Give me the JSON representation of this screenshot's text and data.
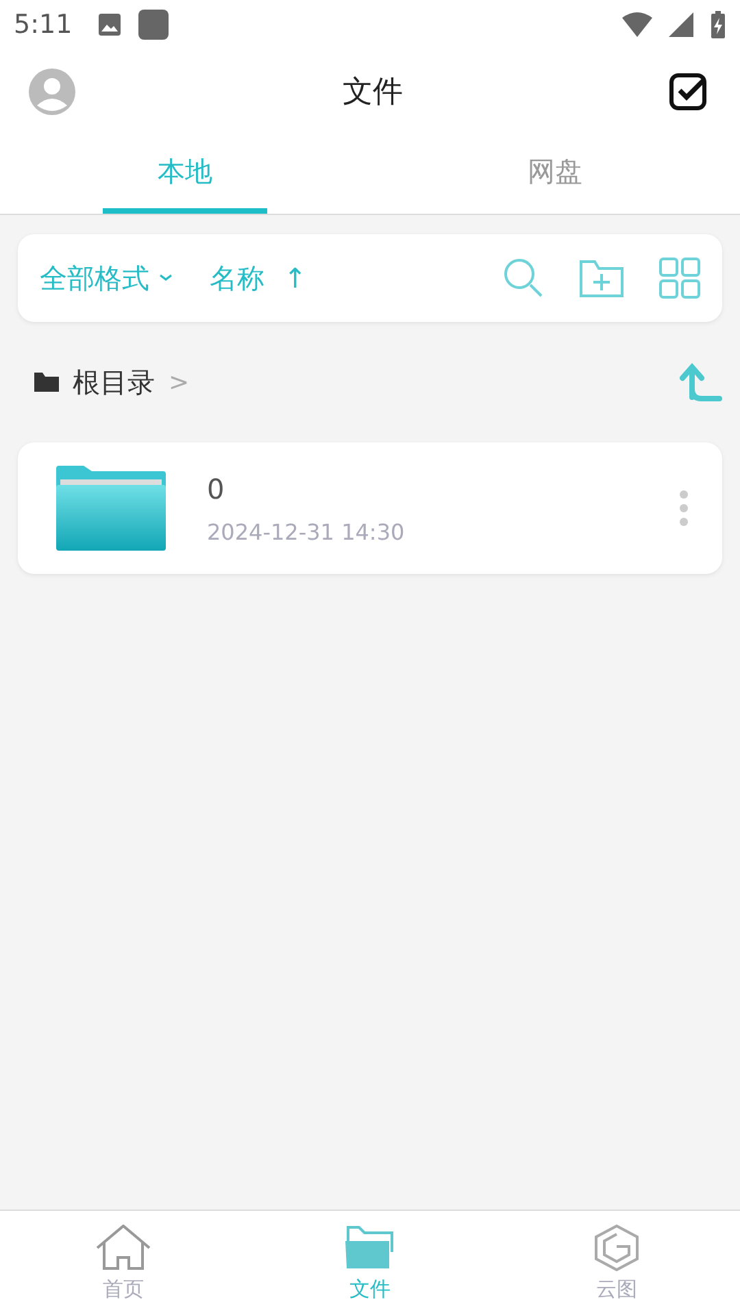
{
  "status_bar": {
    "time": "5:11"
  },
  "header": {
    "title": "文件"
  },
  "tabs": [
    {
      "label": "本地",
      "selected": true
    },
    {
      "label": "网盘",
      "selected": false
    }
  ],
  "toolbar": {
    "format_filter": "全部格式",
    "sort": "名称",
    "sort_arrow": "↑"
  },
  "breadcrumb": {
    "label": "根目录",
    "separator": ">"
  },
  "files": [
    {
      "name": "0",
      "modified": "2024-12-31 14:30"
    }
  ],
  "bottom_nav": [
    {
      "kind": "home",
      "label": "首页",
      "selected": false
    },
    {
      "kind": "folder",
      "label": "文件",
      "selected": true
    },
    {
      "kind": "cloud",
      "label": "云图",
      "selected": false
    }
  ]
}
